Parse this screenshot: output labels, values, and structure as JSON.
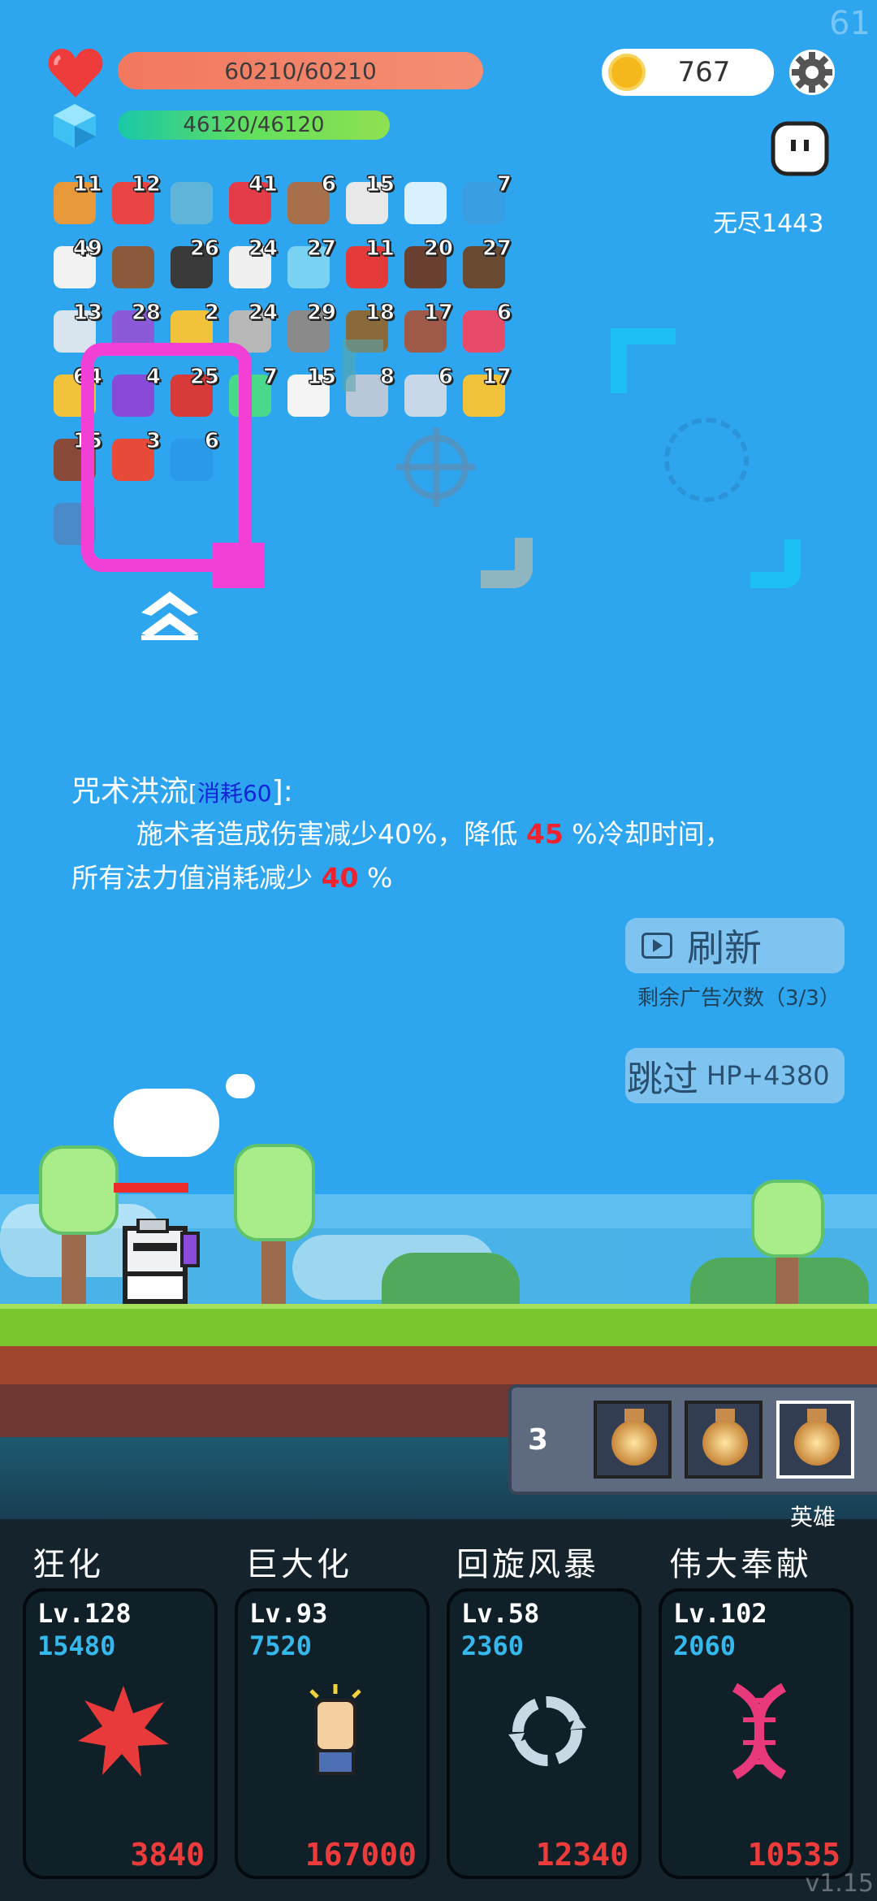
{
  "fps": "61",
  "version": "v1.15",
  "stats": {
    "hp": "60210/60210",
    "mp": "46120/46120",
    "hp_ratio": 1.0,
    "mp_ratio": 1.0
  },
  "coins": "767",
  "mode": "无尽1443",
  "items": [
    {
      "icon": "book-icon",
      "count": "11",
      "color": "#e89a3a"
    },
    {
      "icon": "watermelon-icon",
      "count": "12",
      "color": "#ea4545"
    },
    {
      "icon": "magnifier-icon",
      "count": "",
      "color": "#5fb5d9"
    },
    {
      "icon": "strawberry-icon",
      "count": "41",
      "color": "#e53c4a"
    },
    {
      "icon": "shield-round-icon",
      "count": "6",
      "color": "#a8704a"
    },
    {
      "icon": "dice-icon",
      "count": "15",
      "color": "#e8e8e8"
    },
    {
      "icon": "crosshair-white-icon",
      "count": "",
      "color": "#d9f1ff"
    },
    {
      "icon": "blue-bird-icon",
      "count": "7",
      "color": "#3a9fe2"
    },
    {
      "icon": "pill-icon",
      "count": "49",
      "color": "#f2f2f2"
    },
    {
      "icon": "treasure-chest-icon",
      "count": "",
      "color": "#8a5a3a"
    },
    {
      "icon": "bomb-icon",
      "count": "26",
      "color": "#3a3a3a"
    },
    {
      "icon": "rabbit-icon",
      "count": "24",
      "color": "#f0f0f0"
    },
    {
      "icon": "blue-orb-icon",
      "count": "27",
      "color": "#79d2f2"
    },
    {
      "icon": "red-apple-icon",
      "count": "11",
      "color": "#e53a3a"
    },
    {
      "icon": "coconut-icon",
      "count": "20",
      "color": "#6a4030"
    },
    {
      "icon": "cannon-icon",
      "count": "27",
      "color": "#6a4a30"
    },
    {
      "icon": "letter-icon",
      "count": "13",
      "color": "#d8e4ee"
    },
    {
      "icon": "purple-chest-icon",
      "count": "28",
      "color": "#8a5ad8"
    },
    {
      "icon": "gold-ring-icon",
      "count": "2",
      "color": "#f2c23a"
    },
    {
      "icon": "axe-icon",
      "count": "24",
      "color": "#b8b8b8"
    },
    {
      "icon": "spiked-mace-icon",
      "count": "29",
      "color": "#8a8a8a"
    },
    {
      "icon": "bow-icon",
      "count": "18",
      "color": "#8a6a3a"
    },
    {
      "icon": "door-icon",
      "count": "17",
      "color": "#a05a4a"
    },
    {
      "icon": "jam-jar-icon",
      "count": "6",
      "color": "#e84a6a"
    },
    {
      "icon": "sunflower-icon",
      "count": "64",
      "color": "#f2c23a"
    },
    {
      "icon": "crystal-ball-icon",
      "count": "4",
      "color": "#8a4ad8"
    },
    {
      "icon": "red-shield-icon",
      "count": "25",
      "color": "#d83a3a"
    },
    {
      "icon": "green-spirit-icon",
      "count": "7",
      "color": "#4ad88a"
    },
    {
      "icon": "ghost-icon",
      "count": "15",
      "color": "#f4f4f4"
    },
    {
      "icon": "sword-icon",
      "count": "8",
      "color": "#b8c8d8"
    },
    {
      "icon": "hook-icon",
      "count": "6",
      "color": "#c8d8e8"
    },
    {
      "icon": "magic-wand-icon",
      "count": "17",
      "color": "#f2c23a"
    },
    {
      "icon": "cake-icon",
      "count": "15",
      "color": "#8a4a3a"
    },
    {
      "icon": "heart-fire-icon",
      "count": "3",
      "color": "#e84a3a"
    },
    {
      "icon": "blue-gem-icon",
      "count": "6",
      "color": "#2a9ae8"
    },
    {
      "icon": "",
      "count": "",
      "color": ""
    },
    {
      "icon": "",
      "count": "",
      "color": ""
    },
    {
      "icon": "",
      "count": "",
      "color": ""
    },
    {
      "icon": "",
      "count": "",
      "color": ""
    },
    {
      "icon": "",
      "count": "",
      "color": ""
    },
    {
      "icon": "lightbulb-card-icon",
      "count": "",
      "color": "#4a8ac8"
    }
  ],
  "skill": {
    "name": "咒术洪流",
    "cost_prefix": "[",
    "cost": "消耗60",
    "cost_suffix": "]:",
    "line1_a": "施术者造成伤害减少40%，降低",
    "line1_num": "45",
    "line1_b": "%冷却时间，",
    "line2_a": "所有法力值消耗减少",
    "line2_num": "40",
    "line2_b": "%"
  },
  "refresh": {
    "label": "刷新",
    "ad_count": "剩余广告次数（3/3）"
  },
  "skip": {
    "label": "跳过",
    "bonus": "HP+4380"
  },
  "potions": {
    "count": "3",
    "hero_label": "英雄"
  },
  "abilities": [
    {
      "name": "狂化",
      "level": "Lv.128",
      "cost": "15480",
      "price": "3840",
      "icon": "rage-splash-icon",
      "color": "#e83a3a"
    },
    {
      "name": "巨大化",
      "level": "Lv.93",
      "cost": "7520",
      "price": "167000",
      "icon": "fist-icon",
      "color": "#f2d0a0"
    },
    {
      "name": "回旋风暴",
      "level": "Lv.58",
      "cost": "2360",
      "price": "12340",
      "icon": "whirlwind-icon",
      "color": "#c8d8e4"
    },
    {
      "name": "伟大奉献",
      "level": "Lv.102",
      "cost": "2060",
      "price": "10535",
      "icon": "dna-icon",
      "color": "#e83a7a"
    }
  ]
}
